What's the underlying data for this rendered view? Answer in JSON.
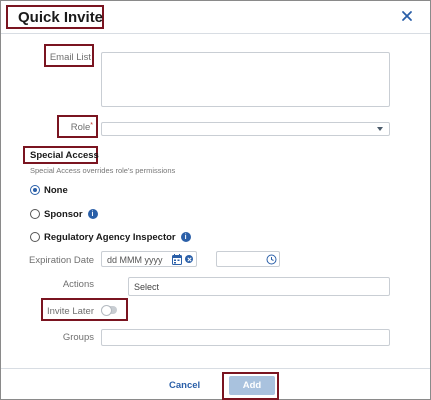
{
  "dialog": {
    "title": "Quick Invite",
    "close_icon": "close-icon"
  },
  "form": {
    "email_list_label": "Email List",
    "email_list_value": "",
    "role_label": "Role",
    "role_required_mark": "*",
    "role_value": "",
    "special_access": {
      "title": "Special Access",
      "subtitle": "Special Access overrides role's permissions",
      "options": [
        {
          "label": "None",
          "selected": true,
          "has_info": false
        },
        {
          "label": "Sponsor",
          "selected": false,
          "has_info": true
        },
        {
          "label": "Regulatory Agency Inspector",
          "selected": false,
          "has_info": true
        }
      ],
      "info_glyph": "i"
    },
    "expiration_date_label": "Expiration Date",
    "expiration_date_placeholder": "dd MMM yyyy",
    "actions_label": "Actions",
    "actions_value": "Select",
    "invite_later_label": "Invite Later",
    "invite_later_on": false,
    "groups_label": "Groups",
    "groups_value": ""
  },
  "footer": {
    "cancel_label": "Cancel",
    "add_label": "Add"
  },
  "colors": {
    "accent": "#2a5fa8",
    "highlight_border": "#7a1420",
    "add_button_disabled": "#a9c2de"
  }
}
